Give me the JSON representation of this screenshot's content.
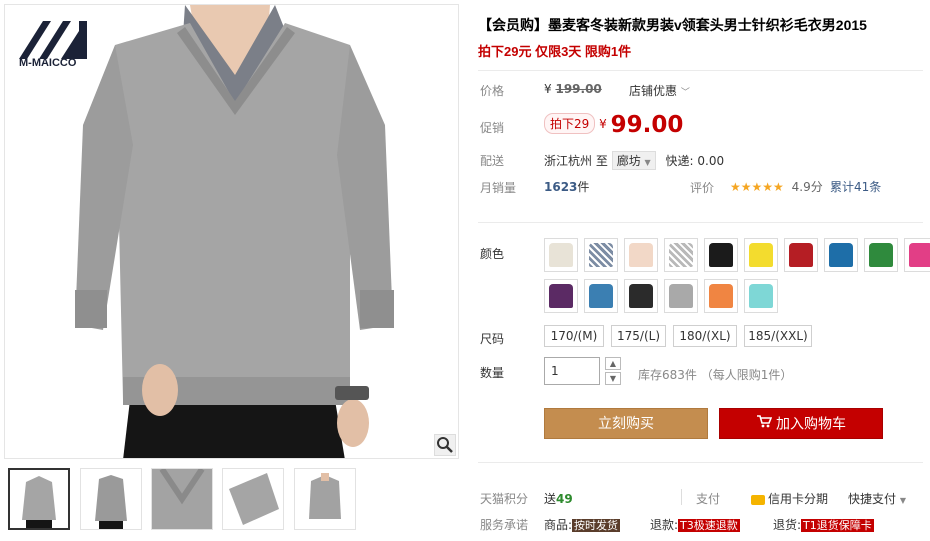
{
  "brand": {
    "logo_text": "M-MAICCO"
  },
  "product": {
    "title": "【会员购】墨麦客冬装新款男装v领套头男士针织衫毛衣男2015",
    "subtitle": "拍下29元 仅限3天 限购1件"
  },
  "price": {
    "label": "价格",
    "currency": "¥",
    "original": "199.00",
    "shop_discount": "店铺优惠"
  },
  "promo": {
    "label": "促销",
    "tag": "拍下29",
    "currency": "¥",
    "value": "99.00"
  },
  "delivery": {
    "label": "配送",
    "from": "浙江杭州",
    "to_word": "至",
    "to_city": "廊坊",
    "express": "快递: 0.00"
  },
  "sales": {
    "label": "月销量",
    "count": "1623",
    "unit": "件",
    "rating_label": "评价",
    "stars": "★★★★★",
    "score": "4.9分",
    "reviews": "累计41条"
  },
  "colors": {
    "label": "颜色",
    "swatches": [
      "#e8e3d7",
      "#7d8da4",
      "#f2d8c7",
      "#b9b9b9",
      "#1b1b1b",
      "#f3dc2e",
      "#b51e24",
      "#1e6ea8",
      "#2f8a3d",
      "#e23e86",
      "#5b2a64",
      "#3b7fb2",
      "#2b2b2b",
      "#a9a9a9",
      "#f08542",
      "#7ed7d6"
    ],
    "patterned": [
      false,
      true,
      false,
      true,
      false,
      false,
      false,
      false,
      false,
      false,
      false,
      false,
      false,
      false,
      false,
      false
    ]
  },
  "sizes": {
    "label": "尺码",
    "options": [
      "170/(M)",
      "175/(L)",
      "180/(XL)",
      "185/(XXL)"
    ]
  },
  "quantity": {
    "label": "数量",
    "value": "1",
    "stock": "库存683件",
    "limit": "（每人限购1件）"
  },
  "buttons": {
    "buy": "立刻购买",
    "cart": "加入购物车"
  },
  "footer": {
    "points_label": "天猫积分",
    "points_prefix": "送",
    "points_value": "49",
    "pay_label": "支付",
    "credit": "信用卡分期",
    "quick_pay": "快捷支付",
    "service_label": "服务承诺",
    "goods_label": "商品:",
    "goods_tag": "按时发货",
    "refund_label": "退款:",
    "refund_tag": "T3极速退款",
    "return_label": "退货:",
    "return_tag": "T1退货保障卡"
  }
}
